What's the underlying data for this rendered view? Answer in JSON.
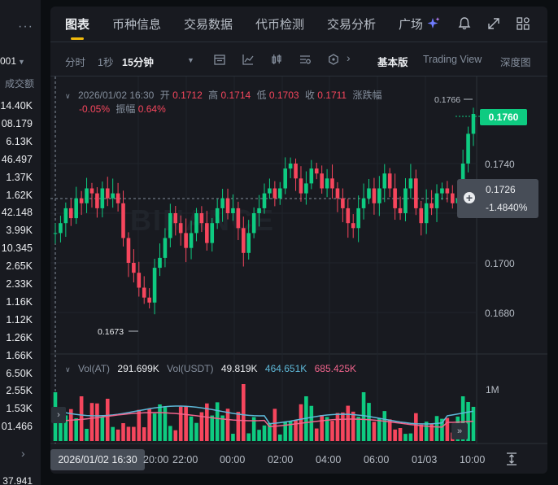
{
  "left_panel": {
    "selector_value": "001",
    "header": "成交额",
    "rows": [
      "14.40K",
      "08.179",
      "6.13K",
      "46.497",
      "1.37K",
      "1.62K",
      "42.148",
      "3.99K",
      "10.345",
      "2.65K",
      "2.33K",
      "1.16K",
      "1.12K",
      "1.26K",
      "1.66K",
      "6.50K",
      "2.55K",
      "1.53K",
      "01.466"
    ],
    "bottom_value": "37.941"
  },
  "tabs": [
    {
      "label": "图表",
      "active": true
    },
    {
      "label": "币种信息"
    },
    {
      "label": "交易数据"
    },
    {
      "label": "代币检测"
    },
    {
      "label": "交易分析"
    },
    {
      "label": "广场"
    }
  ],
  "header_icons": [
    "sparkle-icon",
    "bell-icon",
    "expand-icon",
    "grid-icon"
  ],
  "toolbar": {
    "time_share": "分时",
    "one_sec": "1秒",
    "interval": "15分钟",
    "basic": "基本版",
    "tradingview": "Trading View",
    "depth": "深度图"
  },
  "ohlc": {
    "date": "2026/01/02 16:30",
    "open_label": "开",
    "open": "0.1712",
    "high_label": "高",
    "high": "0.1714",
    "low_label": "低",
    "low": "0.1703",
    "close_label": "收",
    "close": "0.1711",
    "change_label": "涨跌幅",
    "change": "-0.05%",
    "amplitude_label": "振幅",
    "amplitude": "0.64%"
  },
  "price_axis": [
    "0.1740",
    "0.1700",
    "0.1680"
  ],
  "last_price": "0.1760",
  "crosshair": {
    "price": "0.1726",
    "change": "-1.4840%"
  },
  "max_label": "0.1766",
  "min_label": "0.1673",
  "volume": {
    "label": "Vol(AT)",
    "vol": "291.699K",
    "usdt_label": "Vol(USDT)",
    "usdt": "49.819K",
    "ma1": "464.651K",
    "ma2": "685.425K",
    "axis": "1M"
  },
  "time_axis": [
    "20:00",
    "22:00",
    "00:00",
    "02:00",
    "04:00",
    "06:00",
    "01/03",
    "10:00"
  ],
  "crosshair_date": "2026/01/02 16:30",
  "watermark": "BINANCE",
  "colors": {
    "up": "#0ecb81",
    "down": "#f6465d",
    "accent": "#f0b90b"
  }
}
